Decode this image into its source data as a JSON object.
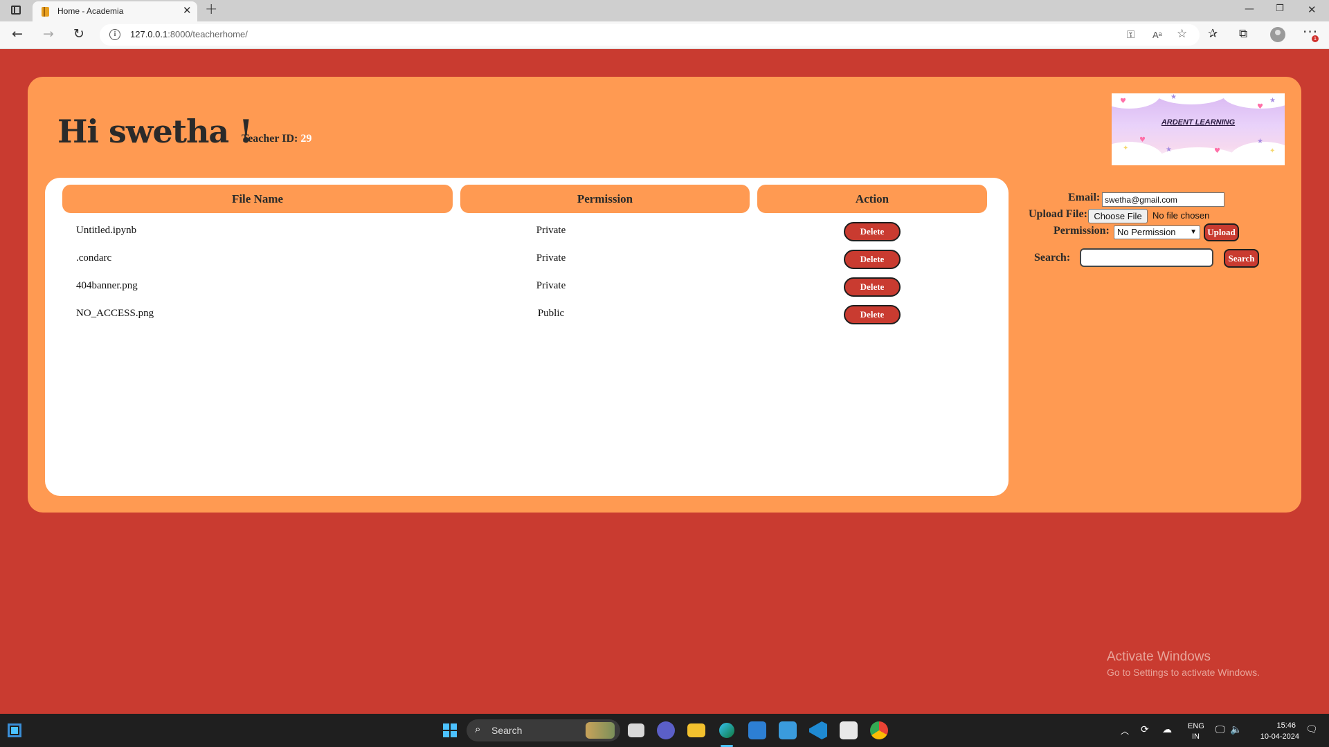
{
  "browser": {
    "tab_title": "Home - Academia",
    "url_host": "127.0.0.1",
    "url_rest": ":8000/teacherhome/"
  },
  "page": {
    "greeting": "Hi swetha !",
    "teacher_id_label": "Teacher ID:",
    "teacher_id_value": "29",
    "logo_text": "ARDENT LEARNING"
  },
  "table": {
    "headers": [
      "File Name",
      "Permission",
      "Action"
    ],
    "rows": [
      {
        "name": "Untitled.ipynb",
        "permission": "Private",
        "action": "Delete"
      },
      {
        "name": ".condarc",
        "permission": "Private",
        "action": "Delete"
      },
      {
        "name": "404banner.png",
        "permission": "Private",
        "action": "Delete"
      },
      {
        "name": "NO_ACCESS.png",
        "permission": "Public",
        "action": "Delete"
      }
    ]
  },
  "form": {
    "email_label": "Email:",
    "email_value": "swetha@gmail.com",
    "upload_label": "Upload File:",
    "choose_file": "Choose File",
    "no_file": "No file chosen",
    "permission_label": "Permission:",
    "permission_selected": "No Permission",
    "upload_button": "Upload",
    "search_label": "Search:",
    "search_value": "",
    "search_button": "Search"
  },
  "watermark": {
    "line1": "Activate Windows",
    "line2": "Go to Settings to activate Windows."
  },
  "taskbar": {
    "search_text": "Search",
    "lang1": "ENG",
    "lang2": "IN",
    "time": "15:46",
    "date": "10-04-2024"
  },
  "colors": {
    "page_bg": "#c93b30",
    "card_bg": "#ff9a52",
    "button_red": "#c93b30"
  },
  "icons": [
    "tab-actions-icon",
    "favicon-icon",
    "close-icon",
    "plus-icon",
    "minimize-icon",
    "restore-icon",
    "back-icon",
    "forward-icon",
    "refresh-icon",
    "info-icon",
    "key-icon",
    "read-aloud-icon",
    "favorite-add-icon",
    "favorites-icon",
    "collections-icon",
    "profile-icon",
    "more-icon",
    "windows-start-icon",
    "search-icon"
  ]
}
